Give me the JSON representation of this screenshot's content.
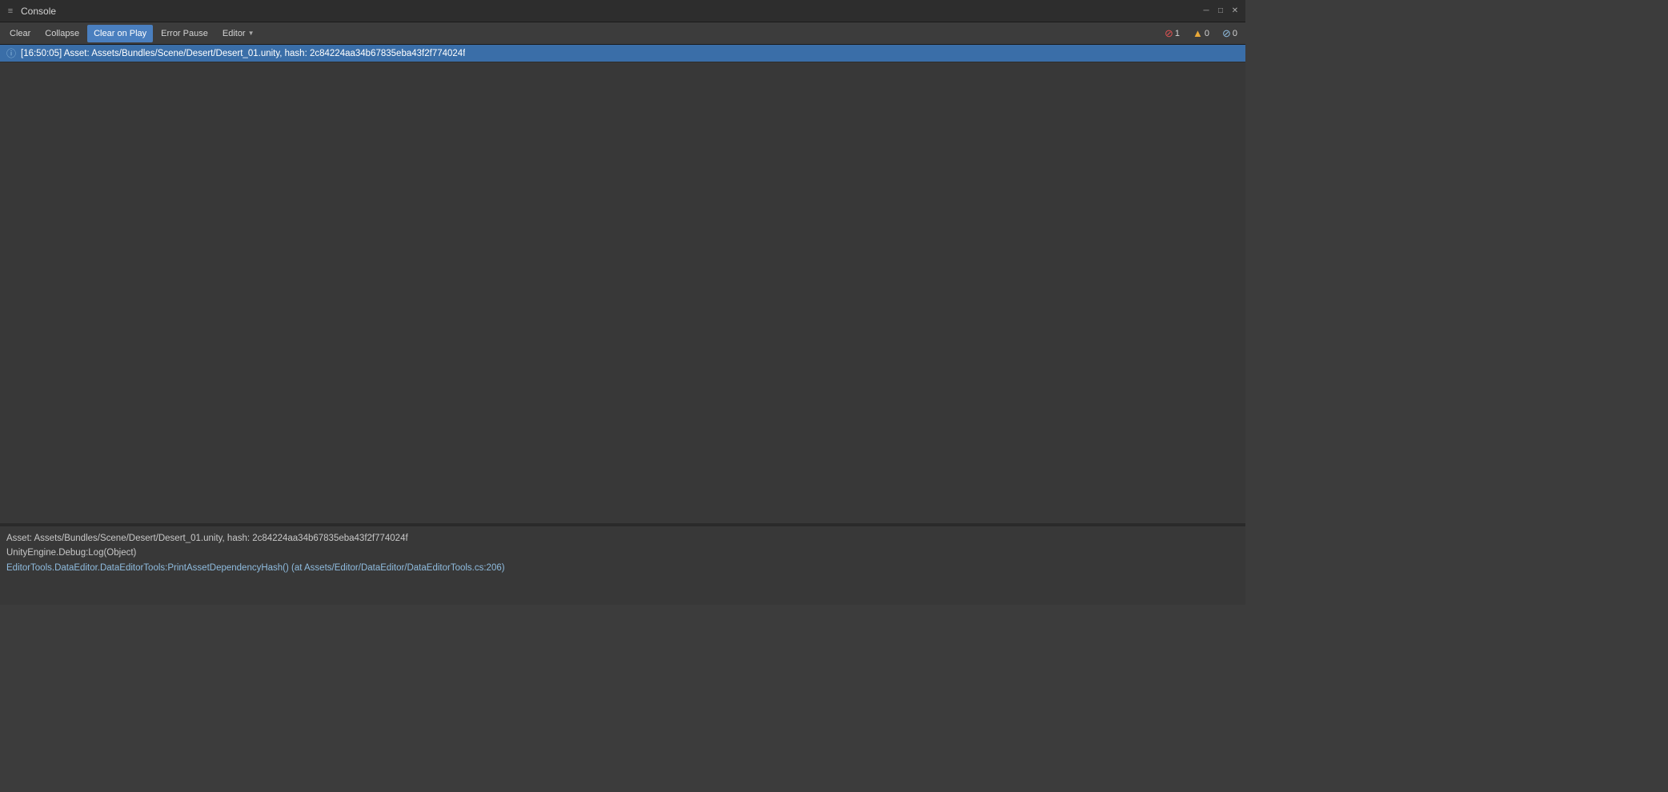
{
  "titleBar": {
    "icon": "≡",
    "title": "Console",
    "buttons": {
      "minimize": "─",
      "maximize": "□",
      "close": "✕"
    }
  },
  "toolbar": {
    "clearLabel": "Clear",
    "collapseLabel": "Collapse",
    "clearOnPlayLabel": "Clear on Play",
    "errorPauseLabel": "Error Pause",
    "editorLabel": "Editor",
    "errorCount": "1",
    "warningCount": "0",
    "infoCount": "0"
  },
  "log": {
    "entries": [
      {
        "id": 1,
        "type": "info",
        "text": "[16:50:05] Asset: Assets/Bundles/Scene/Desert/Desert_01.unity, hash: 2c84224aa34b67835eba43f2f774024f",
        "selected": true
      }
    ]
  },
  "detail": {
    "lines": [
      {
        "text": "Asset: Assets/Bundles/Scene/Desert/Desert_01.unity, hash: 2c84224aa34b67835eba43f2f774024f",
        "type": "normal"
      },
      {
        "text": "UnityEngine.Debug:Log(Object)",
        "type": "normal"
      },
      {
        "text": "EditorTools.DataEditor.DataEditorTools:PrintAssetDependencyHash() (at Assets/Editor/DataEditor/DataEditorTools.cs:206)",
        "type": "stack"
      }
    ]
  }
}
